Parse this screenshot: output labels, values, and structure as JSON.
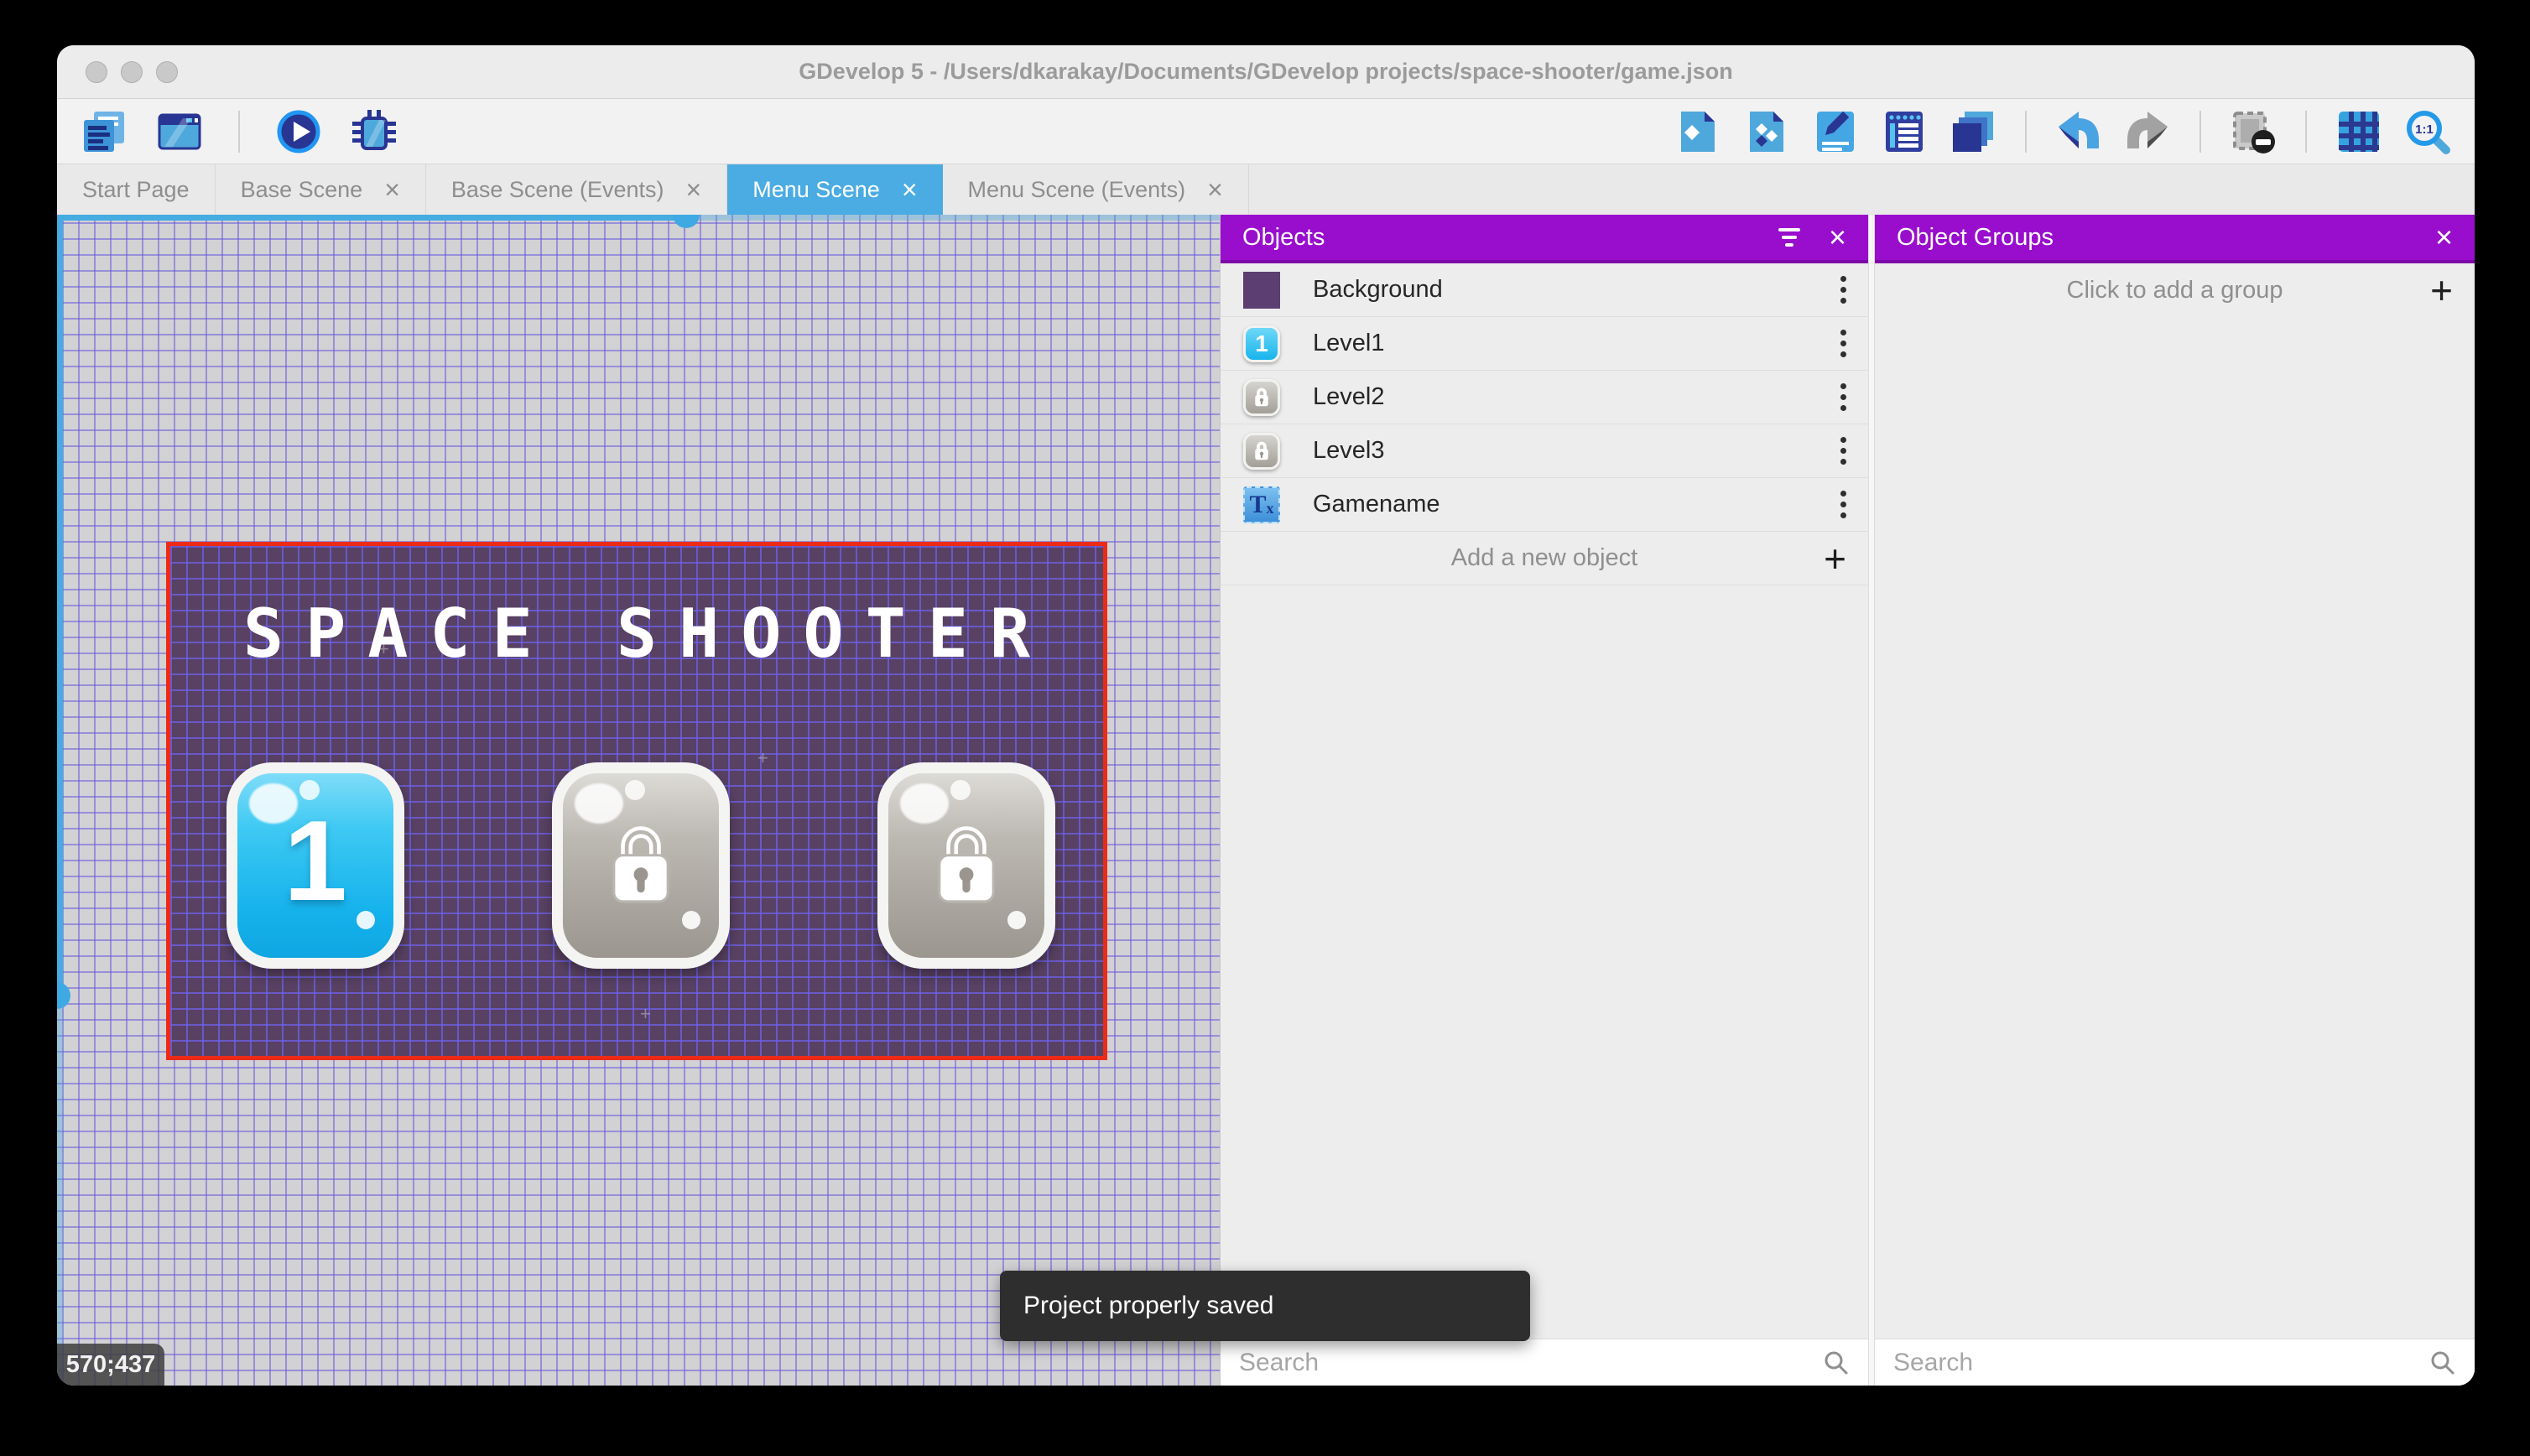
{
  "window": {
    "title": "GDevelop 5 - /Users/dkarakay/Documents/GDevelop projects/space-shooter/game.json"
  },
  "toolbar": {
    "left_icons": [
      "project-manager-icon",
      "scene-window-icon",
      "preview-play-icon",
      "debug-icon"
    ],
    "right_icons": [
      "objects-editor-icon",
      "object-groups-editor-icon",
      "properties-icon",
      "instances-list-icon",
      "layers-icon",
      "undo-icon",
      "redo-icon",
      "selection-mask-icon",
      "grid-icon",
      "zoom-1-1-icon"
    ]
  },
  "tabs": [
    {
      "label": "Start Page",
      "closable": false,
      "active": false
    },
    {
      "label": "Base Scene",
      "closable": true,
      "active": false
    },
    {
      "label": "Base Scene (Events)",
      "closable": true,
      "active": false
    },
    {
      "label": "Menu Scene",
      "closable": true,
      "active": true
    },
    {
      "label": "Menu Scene (Events)",
      "closable": true,
      "active": false
    }
  ],
  "glyphs": {
    "close": "×",
    "plus": "+"
  },
  "canvas": {
    "coordinates": "570;437",
    "scene": {
      "title": "SPACE SHOOTER",
      "buttons": [
        {
          "type": "level",
          "label": "1"
        },
        {
          "type": "locked",
          "label": ""
        },
        {
          "type": "locked",
          "label": ""
        }
      ]
    }
  },
  "objects_panel": {
    "title": "Objects",
    "items": [
      {
        "name": "Background",
        "icon": "background-swatch"
      },
      {
        "name": "Level1",
        "icon": "level-1-button"
      },
      {
        "name": "Level2",
        "icon": "locked-button"
      },
      {
        "name": "Level3",
        "icon": "locked-button"
      },
      {
        "name": "Gamename",
        "icon": "text-object"
      }
    ],
    "add_label": "Add a new object",
    "search_placeholder": "Search"
  },
  "groups_panel": {
    "title": "Object Groups",
    "add_label": "Click to add a group",
    "search_placeholder": "Search"
  },
  "toast": {
    "message": "Project properly saved"
  },
  "colors": {
    "panel_header_purple": "#990ecd",
    "active_tab_blue": "#4aace2",
    "selection_red": "#ec2b17",
    "scene_background": "#584163",
    "grid_line": "#675adb",
    "scrollbar_blue": "#45ace1",
    "toast_background": "#2e2e2e",
    "toolbar_icon_blue": "#4fa8dc",
    "toolbar_icon_navy": "#283593"
  }
}
